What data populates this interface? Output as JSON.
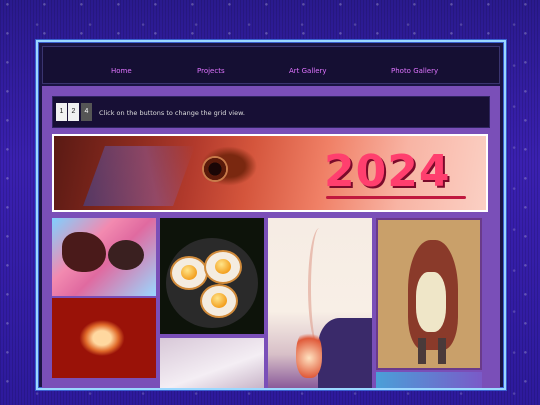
{
  "nav": {
    "items": [
      "Home",
      "Projects",
      "Art Gallery",
      "Photo Gallery"
    ]
  },
  "toolbar": {
    "buttons": [
      "1",
      "2",
      "4"
    ],
    "hint": "Click on the buttons to change the grid view."
  },
  "banner": {
    "year": "2024"
  },
  "colors": {
    "background": "#2d1a9c",
    "frame_border": "#9bd8ff",
    "nav_link": "#e074ff",
    "content_bg": "#7a4fb8",
    "banner_year": "#ff3f6e"
  },
  "gallery": {
    "tiles": [
      "abstract-creature-painting",
      "fiery-bird-painting",
      "fried-eggs-plate-photo",
      "white-bird-painting",
      "smoke-and-fire-painting",
      "horned-creature-illustration",
      "colorful-partial-tile"
    ]
  }
}
